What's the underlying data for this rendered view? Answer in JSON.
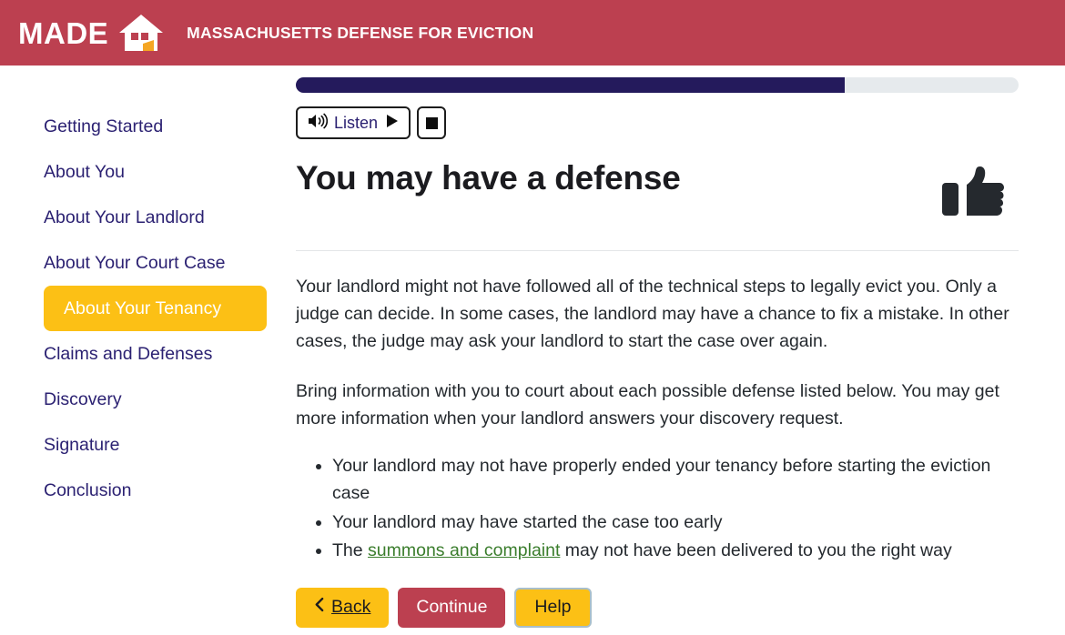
{
  "header": {
    "wordmark": "MADE",
    "tagline": "MASSACHUSETTS DEFENSE FOR EVICTION",
    "brand_color": "#bc4050",
    "house_icon": "house-logo-icon"
  },
  "sidebar": {
    "items": [
      {
        "label": "Getting Started",
        "active": false
      },
      {
        "label": "About You",
        "active": false
      },
      {
        "label": "About Your Landlord",
        "active": false
      },
      {
        "label": "About Your Court Case",
        "active": false
      },
      {
        "label": "About Your Tenancy",
        "active": true
      },
      {
        "label": "Claims and Defenses",
        "active": false
      },
      {
        "label": "Discovery",
        "active": false
      },
      {
        "label": "Signature",
        "active": false
      },
      {
        "label": "Conclusion",
        "active": false
      }
    ],
    "active_bg": "#fcc015",
    "link_color": "#2b2172"
  },
  "progress": {
    "percent": 76,
    "fill_color": "#241a5c",
    "track_color": "#e6eaed"
  },
  "audio": {
    "speaker_icon": "speaker-icon",
    "listen_label": "Listen",
    "play_icon": "play-icon",
    "stop_icon": "stop-icon"
  },
  "main": {
    "title": "You may have a defense",
    "decorative_icon": "thumbs-up-icon",
    "paragraph_1": "Your landlord might not have followed all of the technical steps to legally evict you. Only a judge can decide. In some cases, the landlord may have a chance to fix a mistake. In other cases, the judge may ask your landlord to start the case over again.",
    "paragraph_2": "Bring information with you to court about each possible defense listed below. You may get more information when your landlord answers your discovery request.",
    "list": {
      "item_1": "Your landlord may not have properly ended your tenancy before starting the eviction case",
      "item_2": "Your landlord may have started the case too early",
      "item_3_prefix": "The ",
      "item_3_link": "summons and complaint",
      "item_3_suffix": " may not have been delivered to you the right way",
      "link_color": "#3a7d2c"
    }
  },
  "buttons": {
    "back": "Back",
    "back_icon": "chevron-left-icon",
    "continue": "Continue",
    "help": "Help"
  }
}
